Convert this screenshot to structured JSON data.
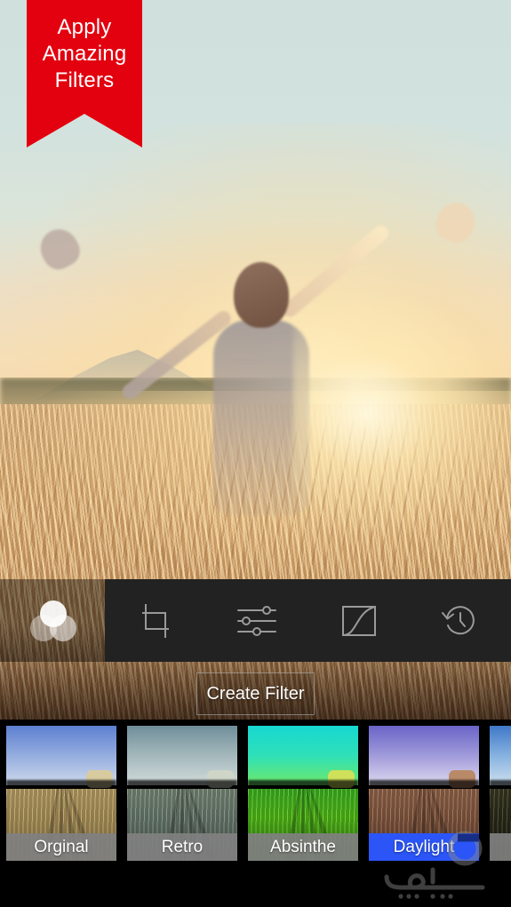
{
  "ribbon": {
    "line1": "Apply",
    "line2": "Amazing",
    "line3": "Filters",
    "color": "#e3000f",
    "text_color": "#ffffff"
  },
  "photo": {
    "description": "Person standing in a wheat field at sunset with arms raised",
    "sky_color": "#cfe0dd",
    "field_color": "#e3b87e"
  },
  "toolbar": {
    "background": "#222222",
    "items": [
      {
        "icon": "filters-circles-icon",
        "name": "filters",
        "active": true
      },
      {
        "icon": "crop-icon",
        "name": "crop",
        "active": false
      },
      {
        "icon": "adjust-sliders-icon",
        "name": "adjust",
        "active": false
      },
      {
        "icon": "curves-icon",
        "name": "curves",
        "active": false
      },
      {
        "icon": "history-clock-icon",
        "name": "history",
        "active": false
      }
    ]
  },
  "create_filter": {
    "label": "Create Filter",
    "text_color": "#ffffff"
  },
  "filter_strip": {
    "selected_color": "#2b55f7",
    "label_bar_color": "#808080",
    "filters": [
      {
        "label": "Orginal",
        "selected": false,
        "class": "t-original"
      },
      {
        "label": "Retro",
        "selected": false,
        "class": "t-retro"
      },
      {
        "label": "Absinthe",
        "selected": false,
        "class": "t-absinthe"
      },
      {
        "label": "Daylight",
        "selected": true,
        "class": "t-daylight"
      },
      {
        "label": "",
        "selected": false,
        "class": "t-next"
      }
    ]
  },
  "watermark": {
    "text": "سافجه",
    "color": "#6b6b6b"
  }
}
